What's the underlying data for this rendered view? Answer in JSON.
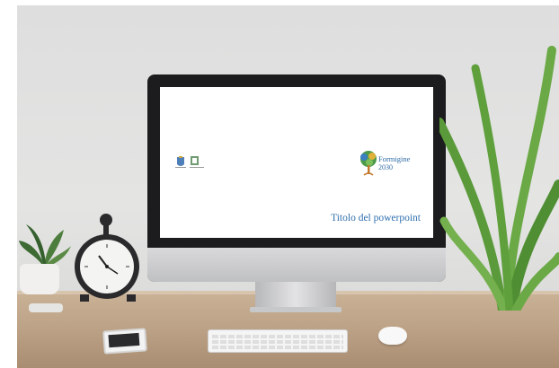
{
  "scene": {
    "objects": [
      "monitor",
      "alarm-clock",
      "small-potted-plant",
      "fern",
      "smartphone",
      "keyboard",
      "mouse"
    ]
  },
  "slide": {
    "title": "Titolo del powerpoint",
    "logo_brand": "Formigine",
    "logo_year": "2030"
  },
  "colors": {
    "slide_text": "#2f6fae",
    "logo_tree": "#4a9a4a"
  }
}
